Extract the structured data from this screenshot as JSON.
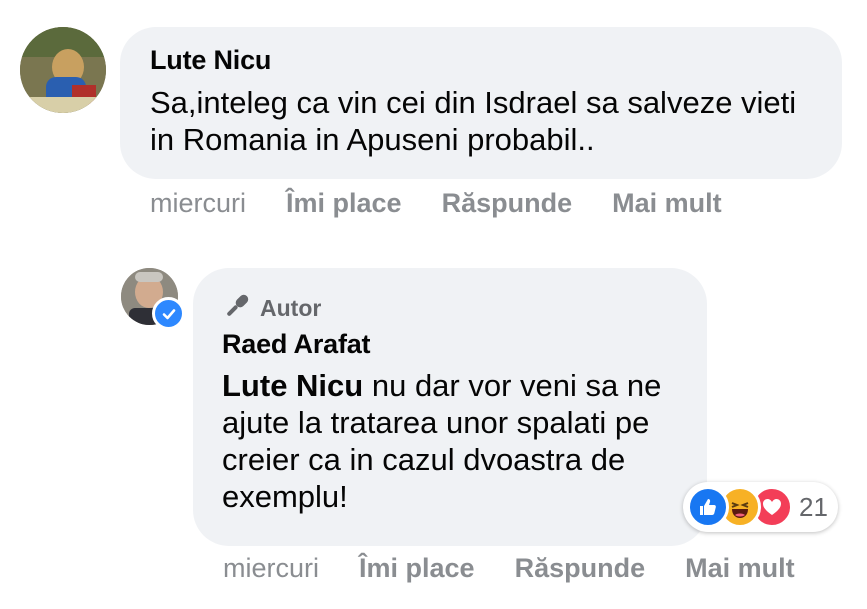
{
  "comment": {
    "author": "Lute Nicu",
    "text": "Sa,inteleg ca vin cei din Isdrael sa salveze vieti in Romania in Apuseni probabil..",
    "actions": {
      "time": "miercuri",
      "like": "Îmi place",
      "reply": "Răspunde",
      "more": "Mai mult"
    }
  },
  "reply": {
    "badge": "Autor",
    "author": "Raed Arafat",
    "mention": "Lute Nicu",
    "text": " nu dar vor veni sa ne ajute la tratarea unor spalati pe creier ca in cazul dvoastra de exemplu!",
    "actions": {
      "time": "miercuri",
      "like": "Îmi place",
      "reply": "Răspunde",
      "more": "Mai mult"
    },
    "reactions": {
      "count": "21",
      "icons": [
        "like-icon",
        "haha-icon",
        "love-icon"
      ]
    }
  },
  "colors": {
    "bubble": "#f0f2f5",
    "meta": "#8a8d91",
    "like": "#1877f2",
    "love": "#f33e58",
    "haha": "#f7b125",
    "verified": "#2d88ff"
  }
}
